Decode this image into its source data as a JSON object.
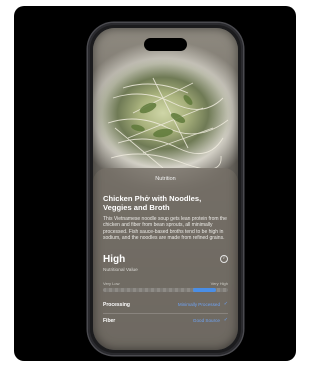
{
  "sheet": {
    "title": "Nutrition",
    "dish_name": "Chicken Phở with Noodles, Veggies and Broth",
    "description": "This Vietnamese noodle soup gets lean protein from the chicken and fiber from bean sprouts, all minimally processed. Fish sauce-based broths tend to be high in sodium, and the noodles are made from refined grains."
  },
  "nutritional_value": {
    "level": "High",
    "label": "Nutritional Value",
    "scale_low": "Very Low",
    "scale_high": "Very High",
    "fill_start_fraction": 0.72,
    "fill_end_fraction": 0.9
  },
  "rows": [
    {
      "key": "Processing",
      "value": "Minimally Processed"
    },
    {
      "key": "Fiber",
      "value": "Good Source"
    }
  ],
  "colors": {
    "accent": "#4a8ee6",
    "link": "#6fa3f5",
    "backdrop": "#000000"
  },
  "icons": {
    "info": "info-icon",
    "check": "checkmark-icon"
  }
}
